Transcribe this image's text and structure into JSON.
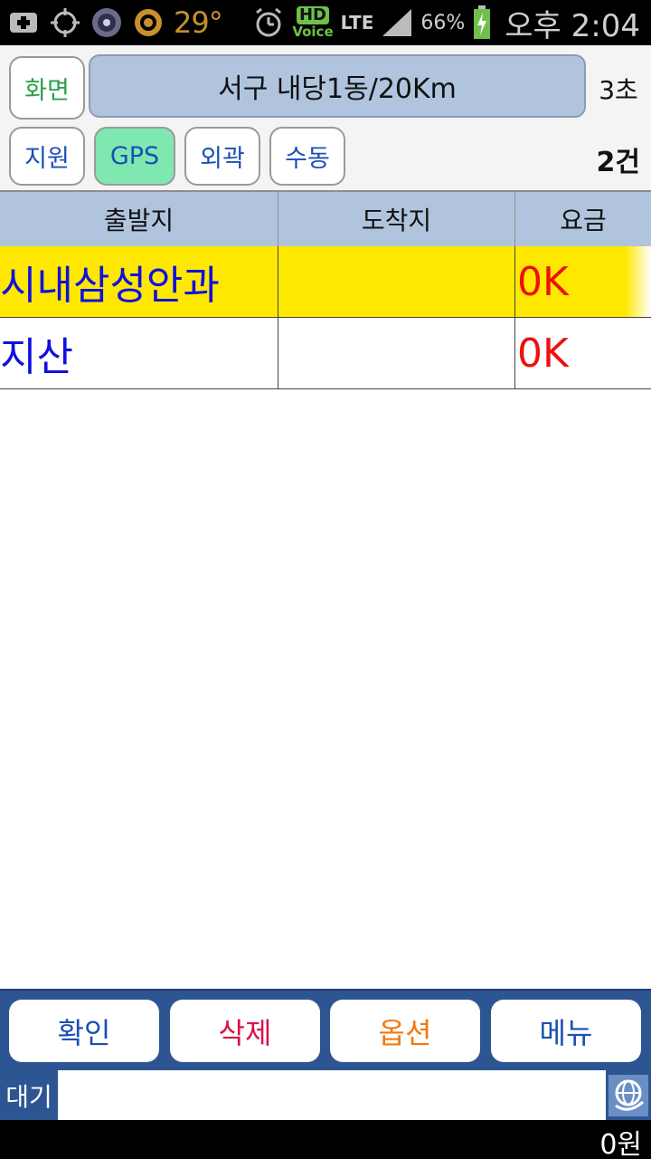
{
  "status_bar": {
    "temperature": "29°",
    "hd_label": "HD",
    "voice_label": "Voice",
    "network": "LTE",
    "battery": "66%",
    "time": "오후 2:04",
    "icons": [
      "add-icon",
      "gps-target-icon",
      "cm-icon",
      "weather-icon",
      "alarm-icon",
      "signal-icon",
      "battery-icon"
    ]
  },
  "header": {
    "screen_button": "화면",
    "region": "서구 내당1동/20Km",
    "seconds": "3초",
    "filters": [
      {
        "label": "지원",
        "active": false
      },
      {
        "label": "GPS",
        "active": true
      },
      {
        "label": "외곽",
        "active": false
      },
      {
        "label": "수동",
        "active": false
      }
    ],
    "count": "2건"
  },
  "table": {
    "columns": [
      "출발지",
      "도착지",
      "요금"
    ],
    "rows": [
      {
        "origin": "시내삼성안과",
        "destination": "",
        "fare": "0K",
        "selected": true
      },
      {
        "origin": "지산",
        "destination": "",
        "fare": "0K",
        "selected": false
      }
    ]
  },
  "bottom": {
    "buttons": [
      "확인",
      "삭제",
      "옵션",
      "메뉴"
    ],
    "wait_label": "대기",
    "message": "",
    "amount": "0원"
  },
  "colors": {
    "accent_blue": "#2d5592",
    "header_blue": "#b0c4de",
    "selected_row": "#ffe800",
    "gps_active": "#7fe8b0",
    "fare_red": "#ee1111",
    "origin_blue": "#1010e0"
  }
}
